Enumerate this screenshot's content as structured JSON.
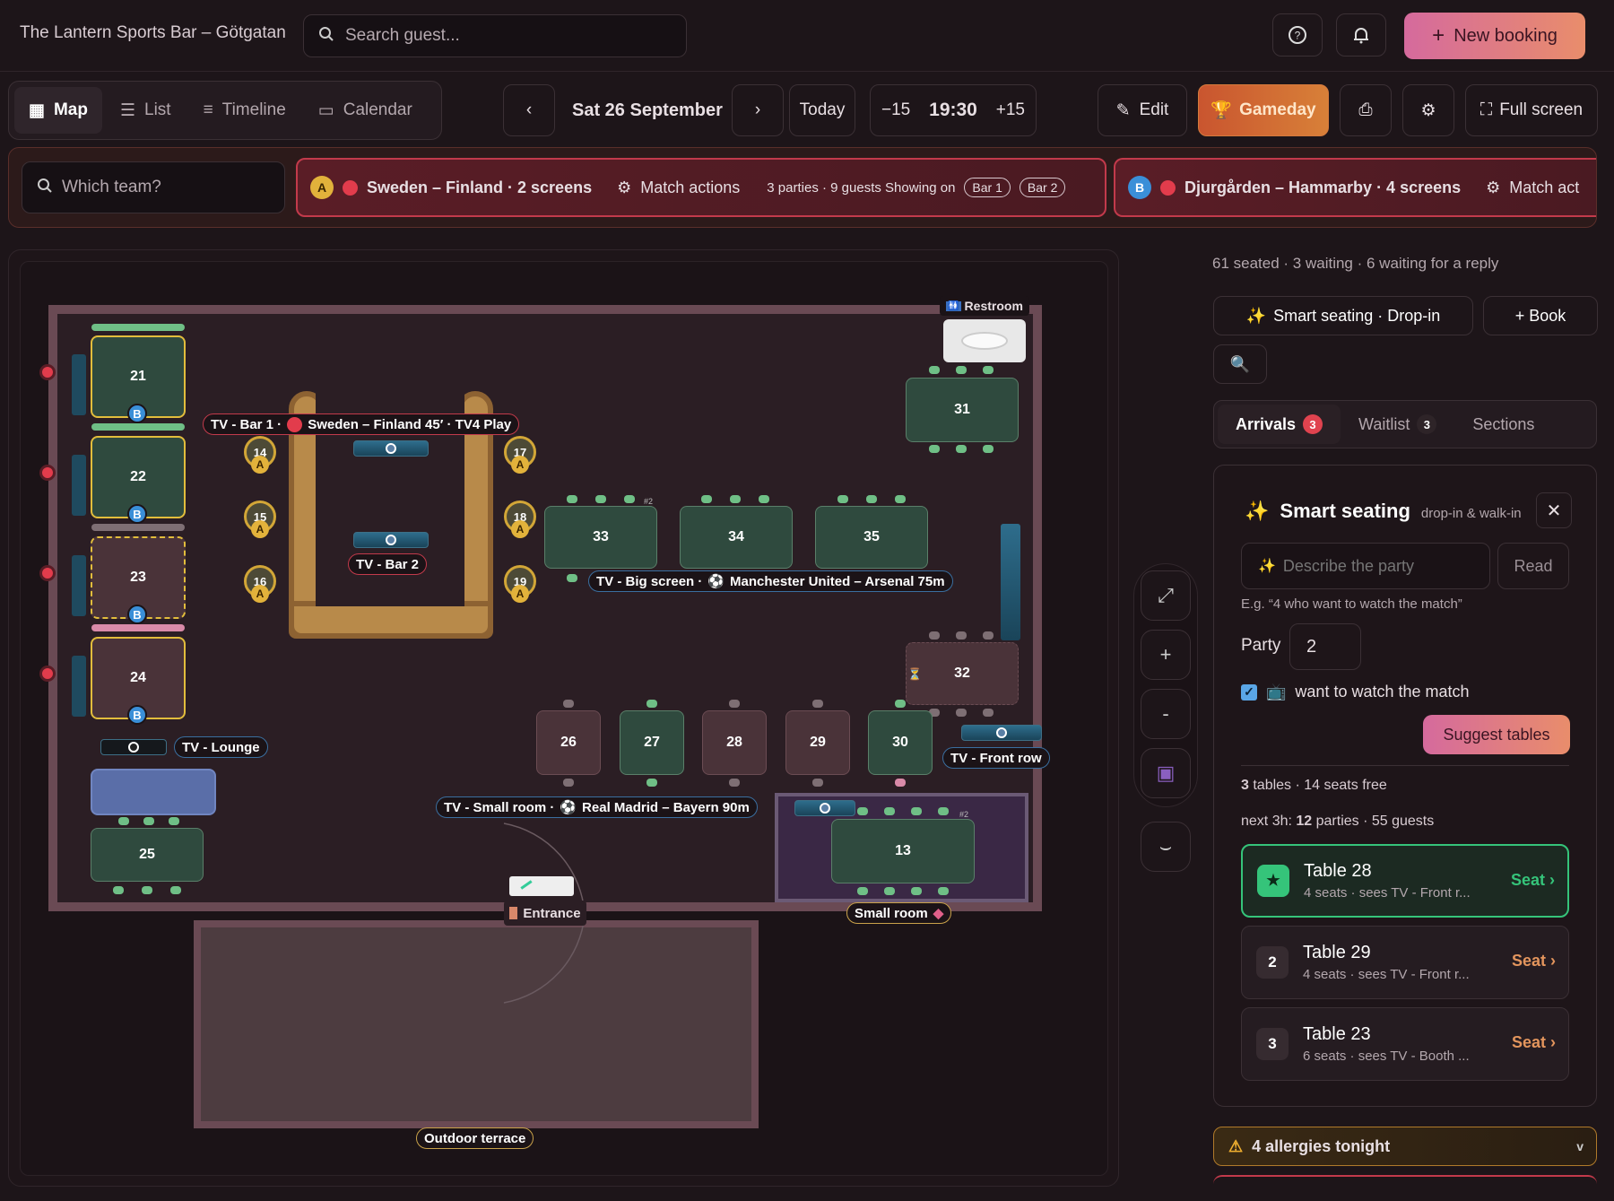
{
  "header": {
    "venue": "The Lantern Sports Bar – Götgatan",
    "search_placeholder": "Search guest...",
    "new_booking": "New booking"
  },
  "views": [
    "Map",
    "List",
    "Timeline",
    "Calendar"
  ],
  "datebar": {
    "prev": "‹",
    "date": "Sat 26 September",
    "next": "›",
    "today": "Today",
    "minus": "−15",
    "time": "19:30",
    "plus": "+15"
  },
  "toolbar": {
    "edit": "Edit",
    "gameday": "Gameday",
    "fullscreen": "Full screen"
  },
  "matches": {
    "search_placeholder": "Which team?",
    "cards": [
      {
        "badge": "A",
        "title": "Sweden – Finland · 2 screens",
        "actions": "Match actions",
        "info": "3 parties · 9 guests  Showing on",
        "pills": [
          "Bar 1",
          "Bar 2"
        ]
      },
      {
        "badge": "B",
        "title": "Djurgården – Hammarby · 4 screens",
        "actions": "Match act"
      }
    ]
  },
  "map": {
    "tables": {
      "t21": "21",
      "t22": "22",
      "t23": "23",
      "t24": "24",
      "t25": "25",
      "t31": "31",
      "t33": "33",
      "t34": "34",
      "t35": "35",
      "t32": "32",
      "t26": "26",
      "t27": "27",
      "t28": "28",
      "t29": "29",
      "t30": "30",
      "t13": "13"
    },
    "bar_seats": {
      "s14": "14",
      "s15": "15",
      "s16": "16",
      "s17": "17",
      "s18": "18",
      "s19": "19"
    },
    "seat_badge": "A",
    "table_badge": "B",
    "tv_bar1": "TV - Bar 1 ·",
    "tv_bar1_match": "Sweden – Finland 45′ · TV4 Play",
    "tv_bar2": "TV - Bar 2",
    "tv_big": "TV - Big screen ·",
    "tv_big_match": "Manchester United – Arsenal 75m",
    "tv_lounge": "TV - Lounge",
    "tv_front": "TV - Front row",
    "tv_small": "TV - Small room ·",
    "tv_small_match": "Real Madrid – Bayern 90m",
    "restroom": "Restroom",
    "entrance": "Entrance",
    "small_room": "Small room",
    "outdoor": "Outdoor terrace",
    "pair_tag": "#2"
  },
  "sidebar": {
    "stats": "61 seated  ·  3 waiting  ·  6 waiting for a reply",
    "smart_btn": "Smart seating · Drop-in",
    "book_btn": "+ Book",
    "tabs": [
      {
        "label": "Arrivals",
        "count": "3"
      },
      {
        "label": "Waitlist",
        "count": "3"
      },
      {
        "label": "Sections"
      }
    ],
    "smart": {
      "title": "Smart seating",
      "subtitle": "drop-in & walk-in",
      "describe_placeholder": "Describe the party",
      "read": "Read",
      "hint": "E.g. “4 who want to watch the match”",
      "party_label": "Party",
      "party_value": "2",
      "watch_label": "want to watch the match",
      "suggest": "Suggest tables",
      "summary_n": "3",
      "summary": " tables · 14 seats free",
      "next_prefix": "next 3h: ",
      "next_n": "12",
      "next_suffix": " parties · 55 guests",
      "suggestions": [
        {
          "rank": "★",
          "name": "Table 28",
          "desc": "4 seats · sees TV - Front r...",
          "seat": "Seat ›"
        },
        {
          "rank": "2",
          "name": "Table 29",
          "desc": "4 seats · sees TV - Front r...",
          "seat": "Seat ›"
        },
        {
          "rank": "3",
          "name": "Table 23",
          "desc": "6 seats · sees TV - Booth ...",
          "seat": "Seat ›"
        }
      ]
    },
    "allergies": "4 allergies tonight",
    "allergies_chev": "v"
  },
  "colors": {
    "accent": "#d56a9d",
    "gameday": "#d06a33",
    "danger": "#e23c4c",
    "table_green": "#2f4a3e",
    "table_pink": "#4a3339",
    "best": "#35c47a"
  }
}
